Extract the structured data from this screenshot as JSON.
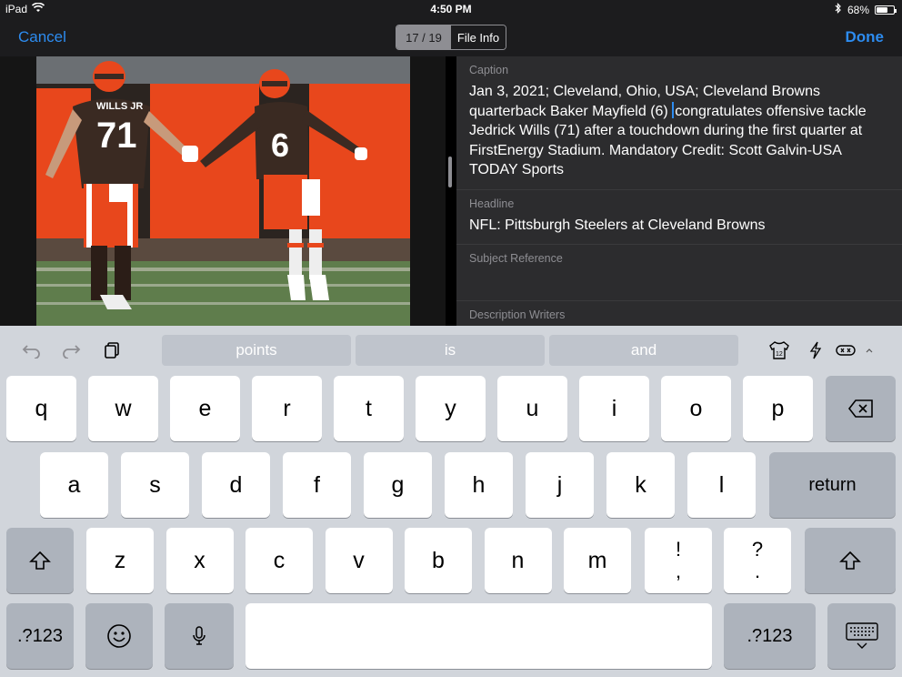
{
  "status": {
    "device": "iPad",
    "time": "4:50 PM",
    "battery": "68%",
    "battery_level": 0.68
  },
  "nav": {
    "cancel": "Cancel",
    "counter": "17 / 19",
    "file_info": "File Info",
    "done": "Done"
  },
  "photo": {
    "player_left_name": "WILLS JR",
    "player_left_number": "71",
    "player_right_number": "6"
  },
  "fields": {
    "caption": {
      "label": "Caption",
      "before_caret": "Jan 3, 2021; Cleveland, Ohio, USA; Cleveland Browns quarterback Baker Mayfield (6) ",
      "after_caret": "congratulates offensive tackle Jedrick Wills (71) after a touchdown during the first quarter at FirstEnergy Stadium. Mandatory Credit: Scott Galvin-USA TODAY Sports"
    },
    "headline": {
      "label": "Headline",
      "value": "NFL: Pittsburgh Steelers at Cleveland Browns"
    },
    "subject_reference": {
      "label": "Subject Reference",
      "value": ""
    },
    "description_writers": {
      "label": "Description Writers",
      "value": ""
    }
  },
  "keyboard": {
    "suggestions": [
      "points",
      "is",
      "and"
    ],
    "row1": [
      "q",
      "w",
      "e",
      "r",
      "t",
      "y",
      "u",
      "i",
      "o",
      "p"
    ],
    "row2": [
      "a",
      "s",
      "d",
      "f",
      "g",
      "h",
      "j",
      "k",
      "l"
    ],
    "row3": [
      "z",
      "x",
      "c",
      "v",
      "b",
      "n",
      "m"
    ],
    "punct1": {
      "top": "!",
      "bottom": ","
    },
    "punct2": {
      "top": "?",
      "bottom": "."
    },
    "return": "return",
    "numbers": ".?123",
    "jersey_number": "12"
  },
  "colors": {
    "accent": "#2d8cf0",
    "browns_orange": "#e8471c",
    "browns_brown": "#3a2a22"
  }
}
